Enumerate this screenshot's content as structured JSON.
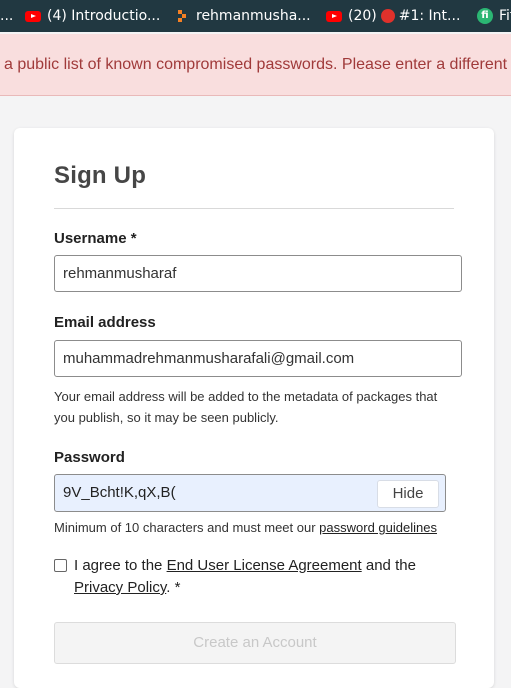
{
  "bookmarks": [
    {
      "label": "...",
      "icon": "none"
    },
    {
      "label": "(4) Introductio...",
      "icon": "youtube-icon"
    },
    {
      "label": "rehmanmusha...",
      "icon": "stackoverflow-icon"
    },
    {
      "label_before": "(20)",
      "label_after": "#1: Int...",
      "icon": "youtube-icon"
    },
    {
      "label": "Fit",
      "icon": "fiverr-icon"
    }
  ],
  "alert": {
    "text": "a public list of known compromised passwords. Please enter a different passw"
  },
  "form": {
    "title": "Sign Up",
    "username_label": "Username *",
    "username_value": "rehmanmusharaf",
    "email_label": "Email address",
    "email_value": "muhammadrehmanmusharafali@gmail.com",
    "email_help": "Your email address will be added to the metadata of packages that you publish, so it may be seen publicly.",
    "password_label": "Password",
    "password_value": "9V_Bcht!K,qX,B(",
    "hide_label": "Hide",
    "password_help_prefix": "Minimum of 10 characters and must meet our ",
    "password_help_link": "password guidelines",
    "agree_prefix": "I agree to the ",
    "agree_link1": "End User License Agreement",
    "agree_mid": " and the ",
    "agree_link2": "Privacy Policy",
    "agree_suffix": ". *",
    "submit_label": "Create an Account"
  },
  "colors": {
    "bookmark_bar": "#213841",
    "alert_bg": "#f9dede",
    "alert_text": "#a03a3a",
    "password_field_bg": "#e8f0fe"
  }
}
